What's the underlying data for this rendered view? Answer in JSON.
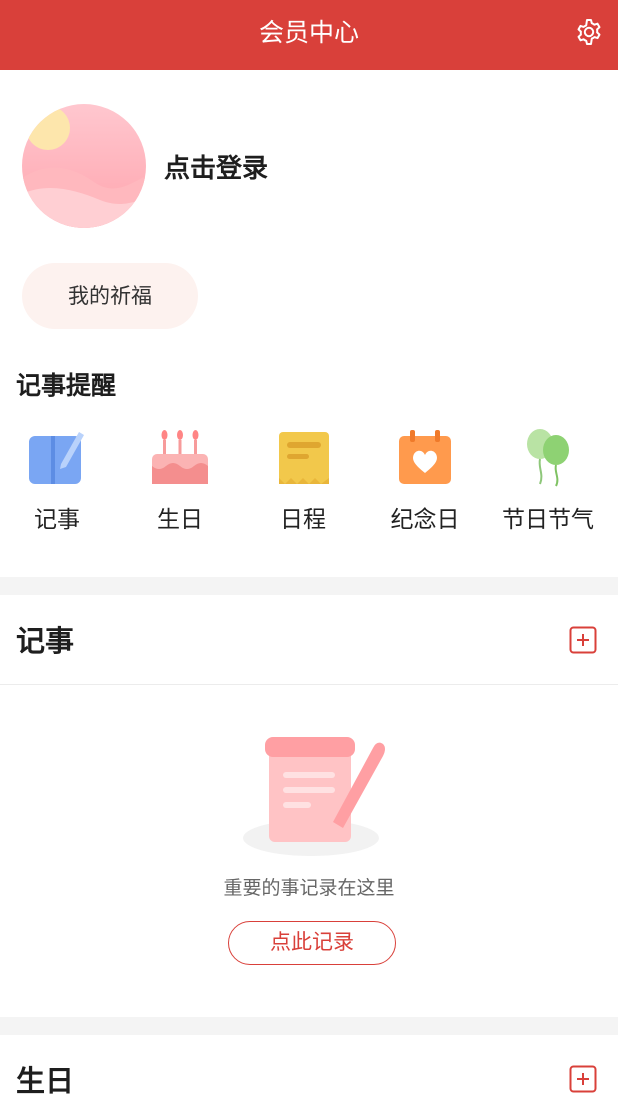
{
  "header": {
    "title": "会员中心",
    "settings_icon": "gear-icon",
    "bg_color": "#d9403a"
  },
  "profile": {
    "login_label": "点击登录"
  },
  "blessing": {
    "label": "我的祈福"
  },
  "reminders": {
    "title": "记事提醒",
    "items": [
      {
        "label": "记事",
        "icon": "notebook-icon"
      },
      {
        "label": "生日",
        "icon": "birthday-cake-icon"
      },
      {
        "label": "日程",
        "icon": "schedule-icon"
      },
      {
        "label": "纪念日",
        "icon": "calendar-heart-icon"
      },
      {
        "label": "节日节气",
        "icon": "balloons-icon"
      }
    ]
  },
  "notes_section": {
    "title": "记事",
    "empty_text": "重要的事记录在这里",
    "record_button": "点此记录"
  },
  "birthday_section": {
    "title": "生日"
  }
}
